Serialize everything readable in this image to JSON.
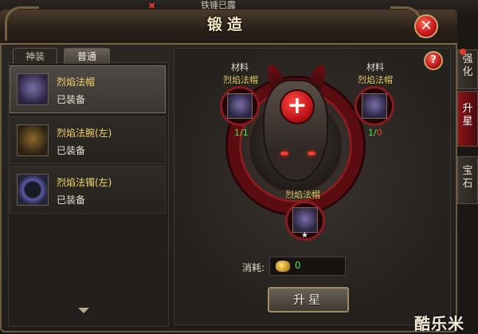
{
  "scene": {
    "caption": "铁锤已露"
  },
  "window": {
    "title": "锻造"
  },
  "tabs": [
    {
      "label": "神装",
      "active": false
    },
    {
      "label": "普通",
      "active": true
    }
  ],
  "items": [
    {
      "name": "烈焰法帽",
      "status": "已装备",
      "icon": "helmet-icon",
      "selected": true
    },
    {
      "name": "烈焰法腕(左)",
      "status": "已装备",
      "icon": "bracer-icon",
      "selected": false
    },
    {
      "name": "烈焰法镯(左)",
      "status": "已装备",
      "icon": "bracelet-icon",
      "selected": false
    }
  ],
  "forge": {
    "material_left": {
      "title": "材料",
      "name": "烈焰法帽",
      "have": "1",
      "need": "1"
    },
    "material_right": {
      "title": "材料",
      "name": "烈焰法帽",
      "have": "1",
      "need": "0"
    },
    "result": {
      "name": "烈焰法帽",
      "stars": "★"
    },
    "cost_label": "消耗:",
    "cost_value": "0",
    "upgrade_label": "升星"
  },
  "side_tabs": [
    {
      "label": "强化",
      "active": false
    },
    {
      "label": "升星",
      "active": true
    },
    {
      "label": "宝石",
      "active": false
    }
  ],
  "watermark": "酷乐米",
  "colors": {
    "accent_red": "#c0141a",
    "gold_text": "#f0d36a",
    "green_count": "#4ee04a"
  }
}
